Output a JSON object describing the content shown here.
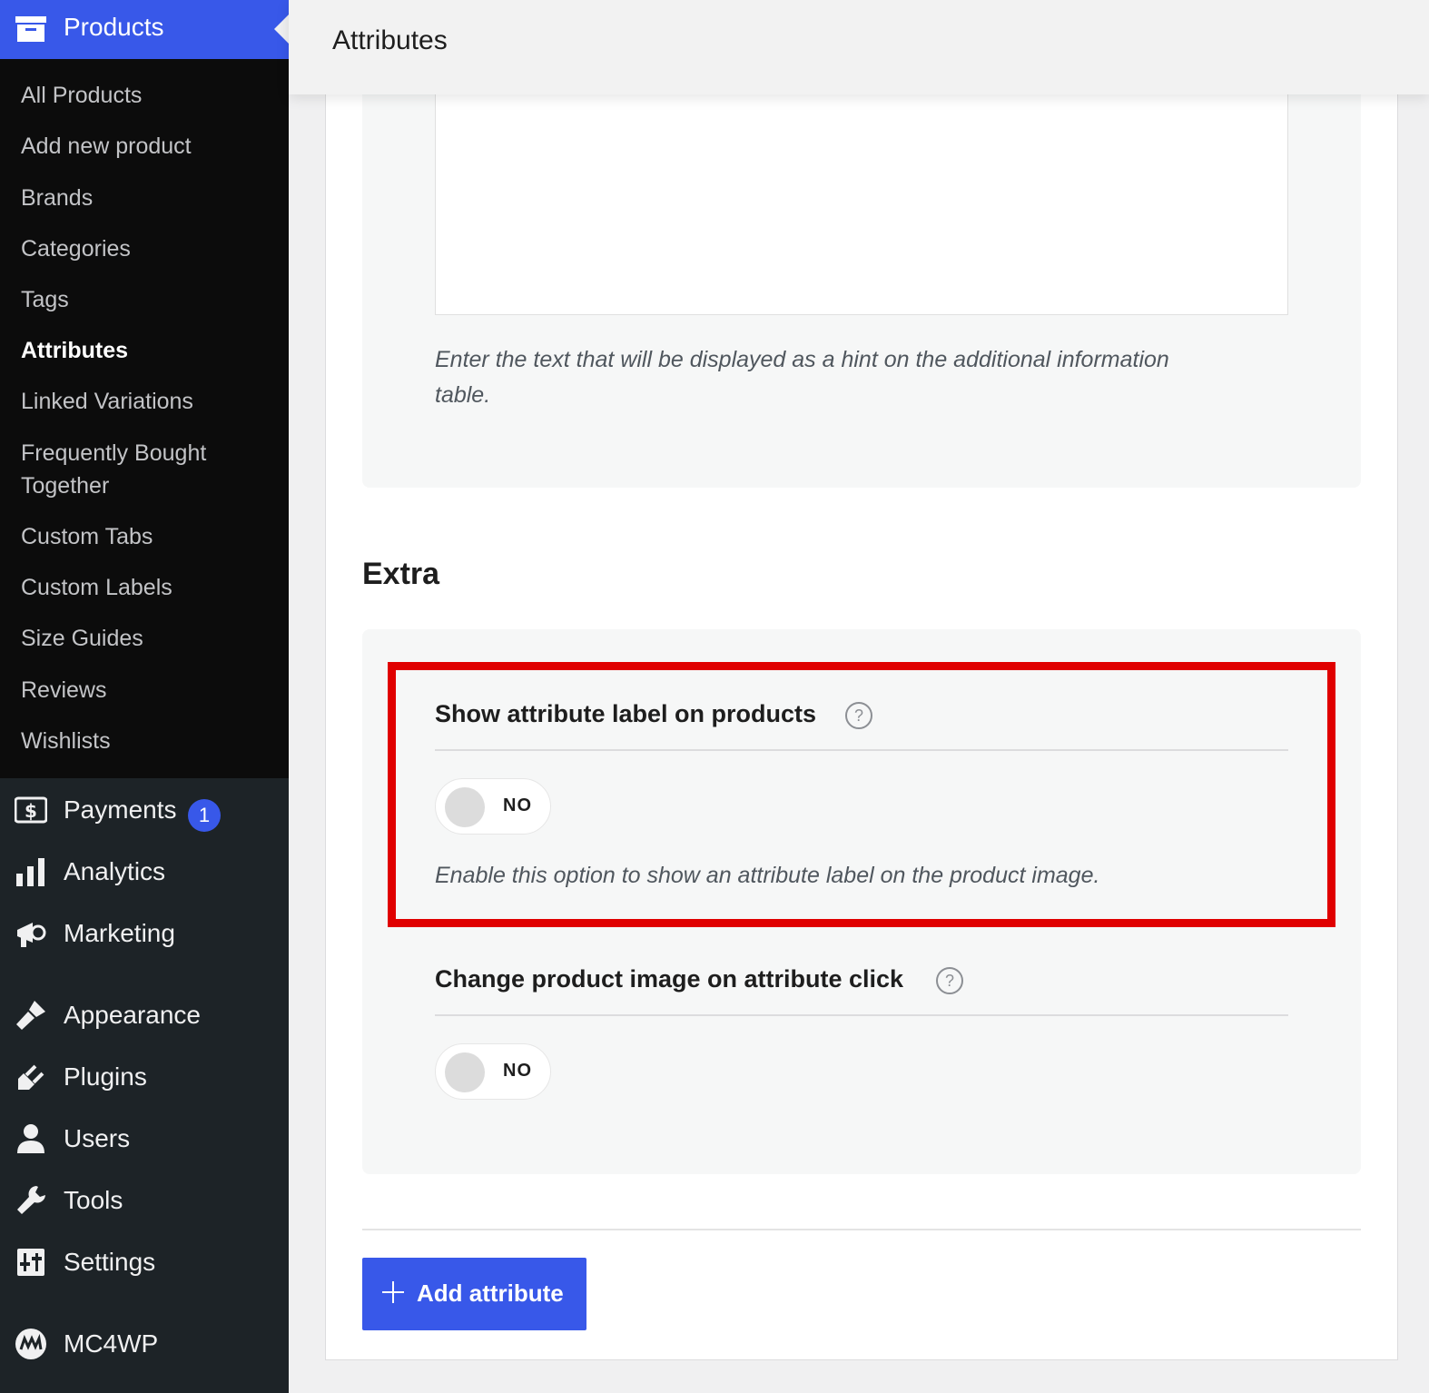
{
  "topbar": {
    "title": "Attributes"
  },
  "sidebar": {
    "header": {
      "label": "Products",
      "icon": "archive-icon"
    },
    "submenu": [
      {
        "label": "All Products"
      },
      {
        "label": "Add new product"
      },
      {
        "label": "Brands"
      },
      {
        "label": "Categories"
      },
      {
        "label": "Tags"
      },
      {
        "label": "Attributes",
        "current": true
      },
      {
        "label": "Linked Variations"
      },
      {
        "label": "Frequently Bought Together"
      },
      {
        "label": "Custom Tabs"
      },
      {
        "label": "Custom Labels"
      },
      {
        "label": "Size Guides"
      },
      {
        "label": "Reviews"
      },
      {
        "label": "Wishlists"
      }
    ],
    "items": [
      {
        "label": "Payments",
        "icon": "dollar-icon",
        "badge": "1"
      },
      {
        "label": "Analytics",
        "icon": "bar-chart-icon"
      },
      {
        "label": "Marketing",
        "icon": "megaphone-icon"
      },
      {
        "label": "Appearance",
        "icon": "paintbrush-icon"
      },
      {
        "label": "Plugins",
        "icon": "plug-icon"
      },
      {
        "label": "Users",
        "icon": "user-icon"
      },
      {
        "label": "Tools",
        "icon": "wrench-icon"
      },
      {
        "label": "Settings",
        "icon": "sliders-icon"
      },
      {
        "label": "MC4WP",
        "icon": "mc4wp-icon"
      }
    ]
  },
  "content": {
    "hint_top": "Enter the text that will be displayed as a hint on the additional information table.",
    "extra_heading": "Extra",
    "options": [
      {
        "title": "Show attribute label on products",
        "help": "?",
        "toggle_state": "NO",
        "description": "Enable this option to show an attribute label on the product image."
      },
      {
        "title": "Change product image on attribute click",
        "help": "?",
        "toggle_state": "NO"
      }
    ],
    "add_button": "Add attribute"
  },
  "colors": {
    "accent": "#3858e9",
    "highlight": "#e00000",
    "sidebar": "#1d2327",
    "submenu": "#0c0c0c"
  }
}
